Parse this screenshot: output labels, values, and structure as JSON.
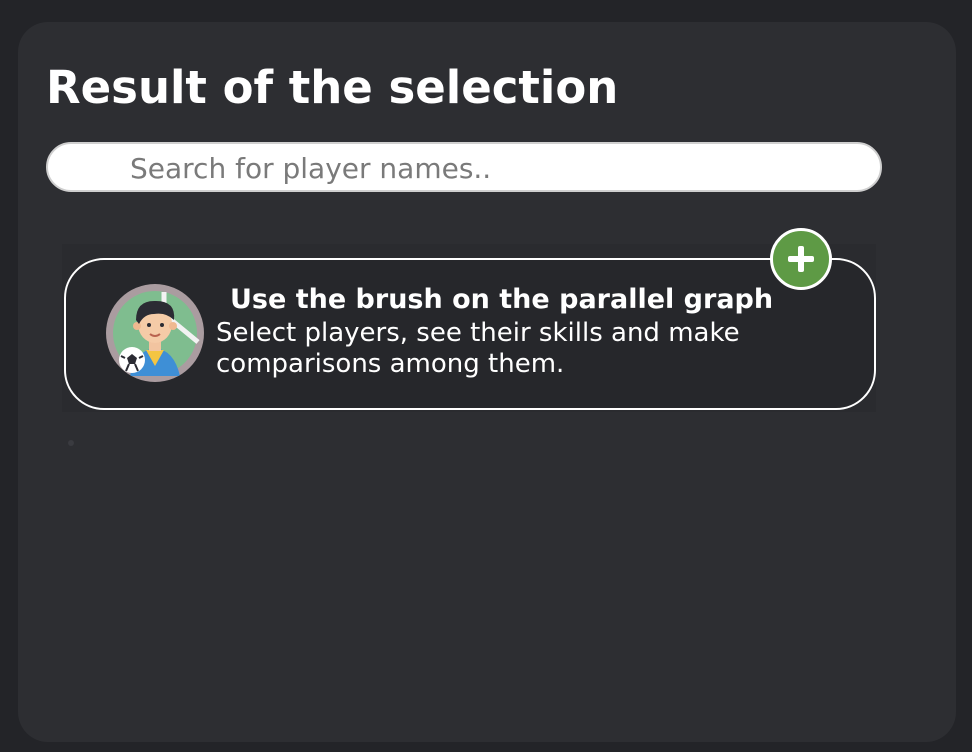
{
  "panel": {
    "title": "Result of the selection"
  },
  "search": {
    "placeholder": "Search for player names.."
  },
  "hint_card": {
    "title": "Use the brush on the parallel graph",
    "description": "Select players, see their skills and make comparisons among them.",
    "avatar_icon": "soccer-player-avatar-icon",
    "add_icon": "plus-icon"
  },
  "colors": {
    "page_bg": "#232428",
    "panel_bg": "#2d2e32",
    "add_button": "#5e9a45",
    "avatar_ring": "#aa9ca0",
    "avatar_bg": "#7fbd8f"
  }
}
